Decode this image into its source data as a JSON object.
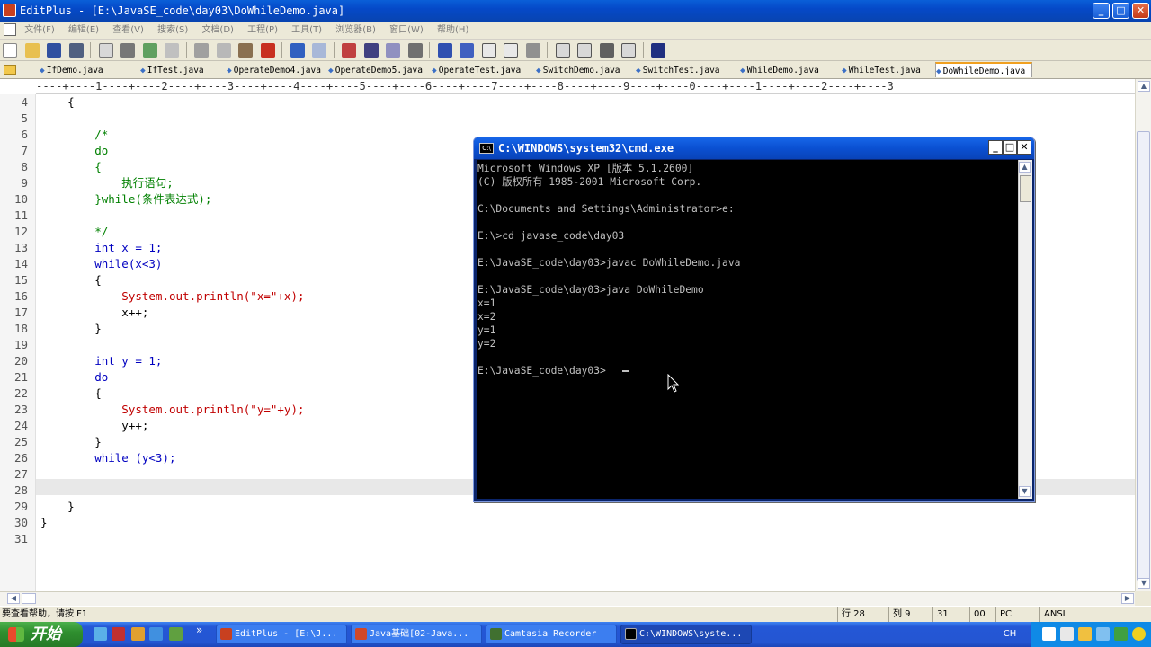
{
  "window": {
    "title": "EditPlus - [E:\\JavaSE_code\\day03\\DoWhileDemo.java]",
    "min": "_",
    "max": "□",
    "close": "✕"
  },
  "menu": [
    "文件(F)",
    "编辑(E)",
    "查看(V)",
    "搜索(S)",
    "文档(D)",
    "工程(P)",
    "工具(T)",
    "浏览器(B)",
    "窗口(W)",
    "帮助(H)"
  ],
  "tabs": [
    {
      "label": "IfDemo.java"
    },
    {
      "label": "IfTest.java"
    },
    {
      "label": "OperateDemo4.java"
    },
    {
      "label": "OperateDemo5.java"
    },
    {
      "label": "OperateTest.java"
    },
    {
      "label": "SwitchDemo.java"
    },
    {
      "label": "SwitchTest.java"
    },
    {
      "label": "WhileDemo.java"
    },
    {
      "label": "WhileTest.java"
    },
    {
      "label": "DoWhileDemo.java",
      "active": true
    }
  ],
  "ruler": "----+----1----+----2----+----3----+----4----+----5----+----6----+----7----+----8----+----9----+----0----+----1----+----2----+----3",
  "editor": {
    "lines": [
      {
        "n": "4",
        "text": "    {"
      },
      {
        "n": "5",
        "text": ""
      },
      {
        "n": "6",
        "text": "        /*"
      },
      {
        "n": "7",
        "text": "        do"
      },
      {
        "n": "8",
        "text": "        {"
      },
      {
        "n": "9",
        "text": "            执行语句;"
      },
      {
        "n": "10",
        "text": "        }while(条件表达式);"
      },
      {
        "n": "11",
        "text": ""
      },
      {
        "n": "12",
        "text": "        */"
      },
      {
        "n": "13",
        "text": "        int x = 1;"
      },
      {
        "n": "14",
        "text": "        while(x<3)"
      },
      {
        "n": "15",
        "text": "        {"
      },
      {
        "n": "16",
        "text": "            System.out.println(\"x=\"+x);"
      },
      {
        "n": "17",
        "text": "            x++;"
      },
      {
        "n": "18",
        "text": "        }"
      },
      {
        "n": "19",
        "text": ""
      },
      {
        "n": "20",
        "text": "        int y = 1;"
      },
      {
        "n": "21",
        "text": "        do"
      },
      {
        "n": "22",
        "text": "        {"
      },
      {
        "n": "23",
        "text": "            System.out.println(\"y=\"+y);"
      },
      {
        "n": "24",
        "text": "            y++;"
      },
      {
        "n": "25",
        "text": "        }"
      },
      {
        "n": "26",
        "text": "        while (y<3);"
      },
      {
        "n": "27",
        "text": ""
      },
      {
        "n": "28",
        "text": ""
      },
      {
        "n": "29",
        "text": "    }"
      },
      {
        "n": "30",
        "text": "}"
      },
      {
        "n": "31",
        "text": ""
      }
    ]
  },
  "cmd": {
    "title": "C:\\WINDOWS\\system32\\cmd.exe",
    "icon_text": "C:\\",
    "lines": [
      "Microsoft Windows XP [版本 5.1.2600]",
      "(C) 版权所有 1985-2001 Microsoft Corp.",
      "",
      "C:\\Documents and Settings\\Administrator>e:",
      "",
      "E:\\>cd javase_code\\day03",
      "",
      "E:\\JavaSE_code\\day03>javac DoWhileDemo.java",
      "",
      "E:\\JavaSE_code\\day03>java DoWhileDemo",
      "x=1",
      "x=2",
      "y=1",
      "y=2",
      "",
      "E:\\JavaSE_code\\day03>"
    ],
    "min": "_",
    "max": "□",
    "close": "✕"
  },
  "status": {
    "help": "要查看帮助，请按 F1",
    "row": "行 28",
    "col": "列 9",
    "total": "31",
    "code": "00",
    "mode": "PC",
    "encoding": "ANSI"
  },
  "taskbar": {
    "start": "开始",
    "more": "»",
    "tasks": [
      {
        "label": "EditPlus - [E:\\J..."
      },
      {
        "label": "Java基础[02-Java..."
      },
      {
        "label": "Camtasia Recorder"
      },
      {
        "label": "C:\\WINDOWS\\syste...",
        "active": true
      }
    ],
    "lang": "CH"
  }
}
